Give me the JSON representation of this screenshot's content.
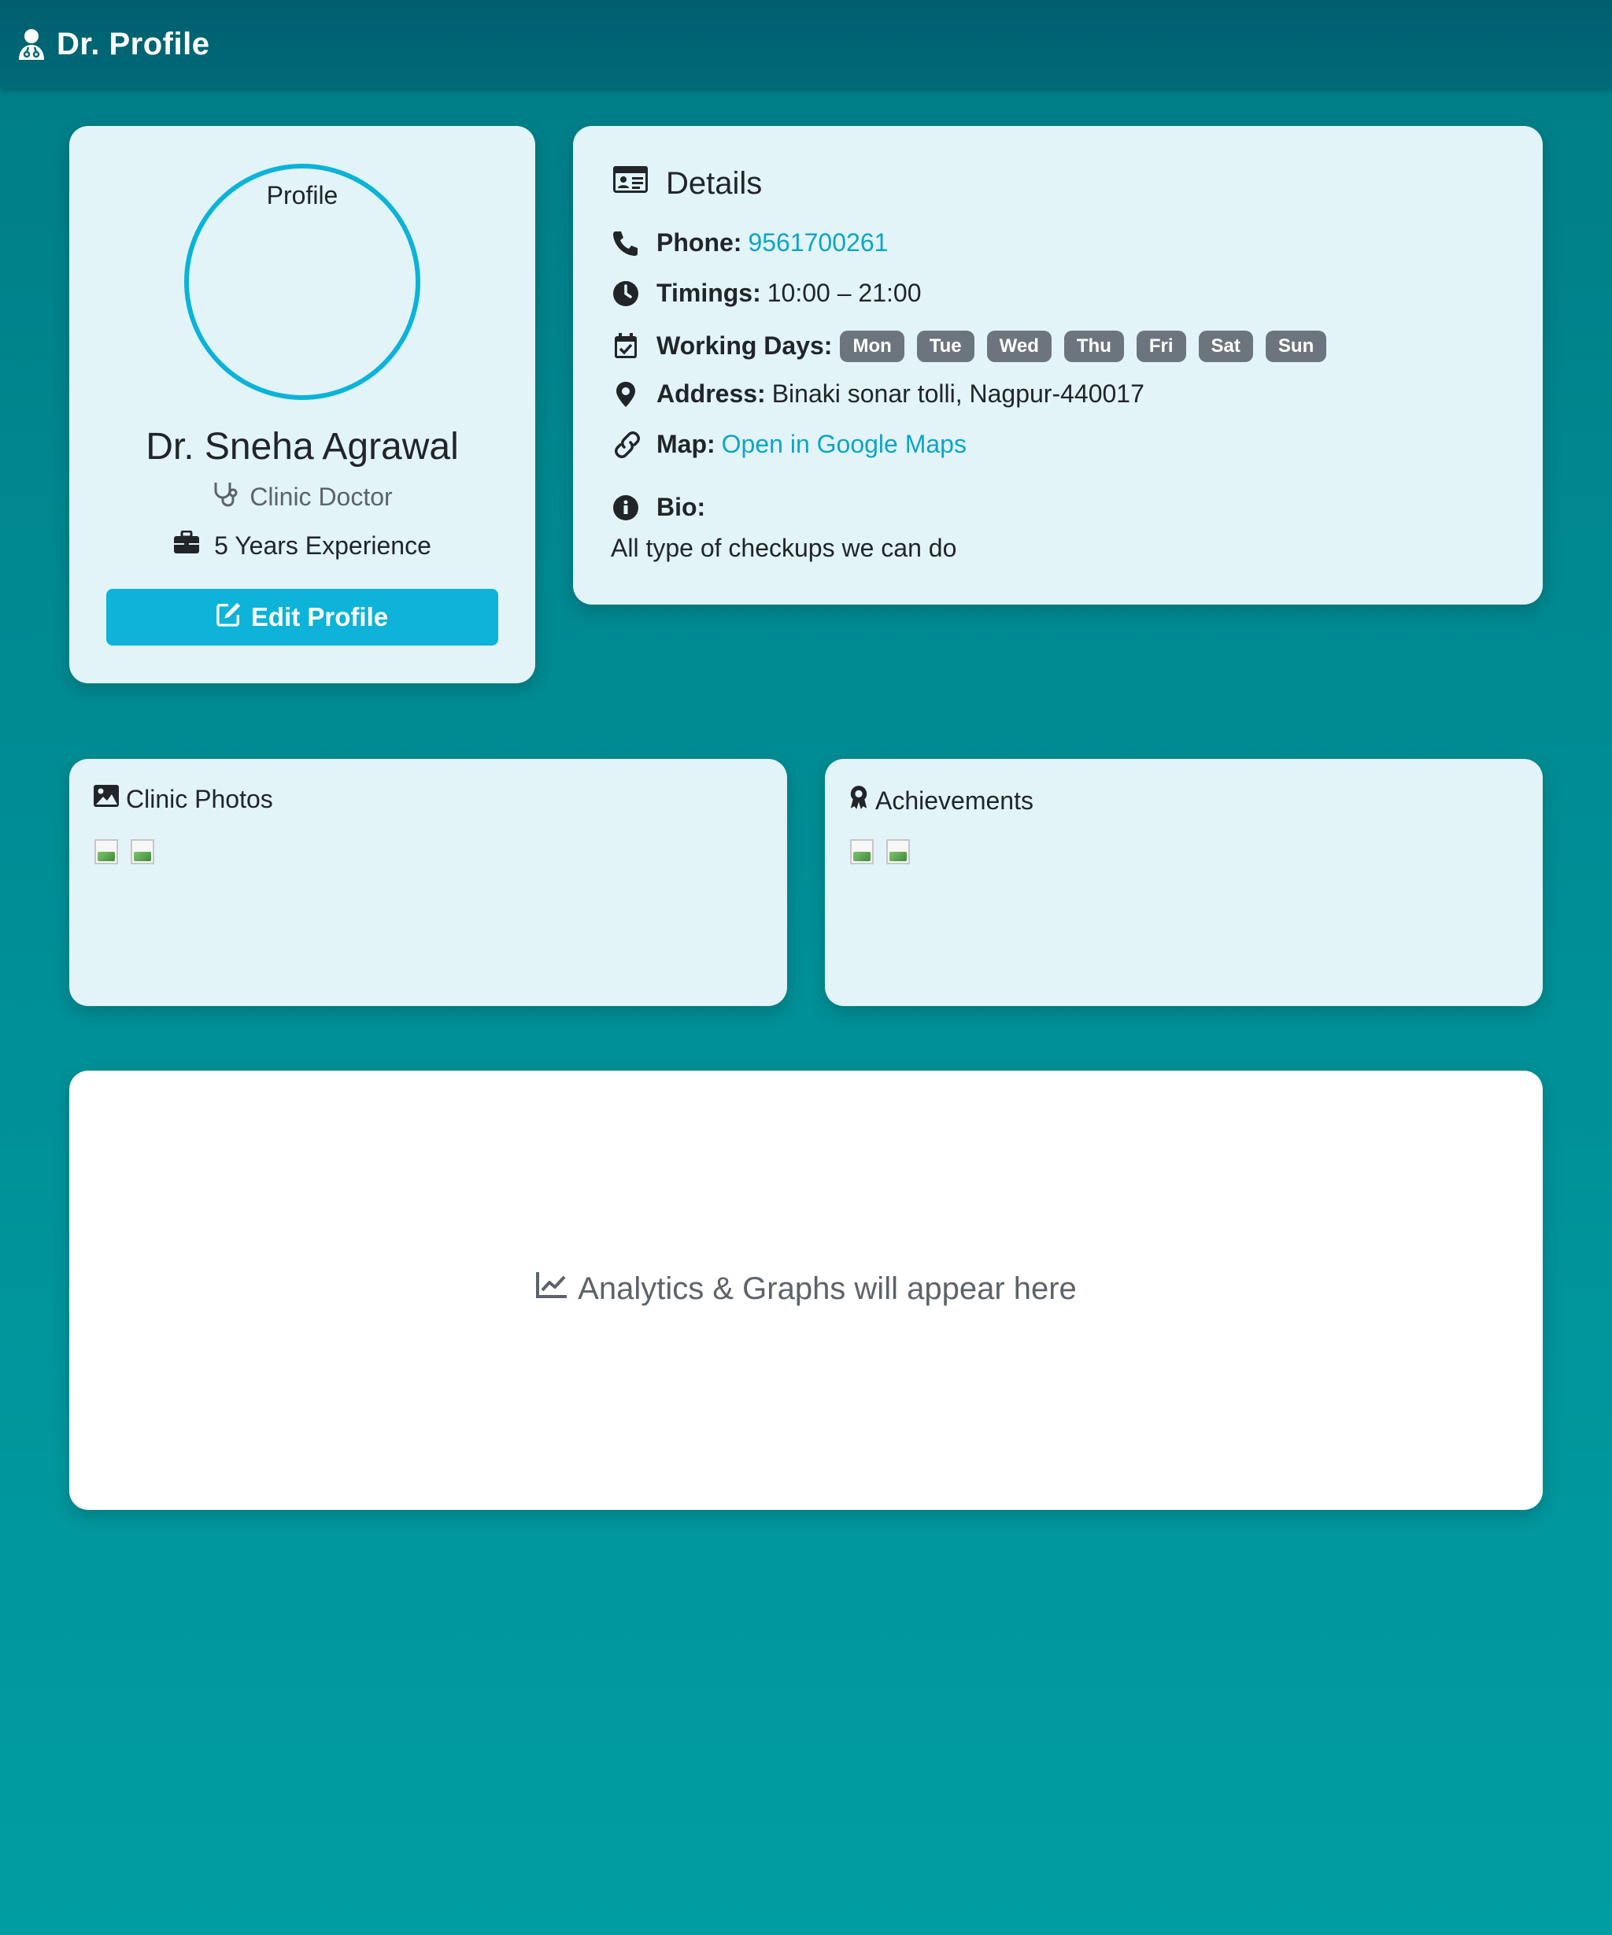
{
  "navbar": {
    "brand_icon": "doctor-icon",
    "brand": "Dr. Profile"
  },
  "profile": {
    "avatar_label": "Profile",
    "name": "Dr. Sneha Agrawal",
    "role_icon": "stethoscope-icon",
    "role": "Clinic Doctor",
    "experience_icon": "briefcase-icon",
    "experience": "5 Years Experience",
    "edit_icon": "edit-icon",
    "edit_label": "Edit Profile"
  },
  "details": {
    "title_icon": "id-card-icon",
    "title": "Details",
    "phone_label": "Phone:",
    "phone": "9561700261",
    "timings_label": "Timings:",
    "timings": "10:00 – 21:00",
    "working_days_label": "Working Days:",
    "working_days": [
      "Mon",
      "Tue",
      "Wed",
      "Thu",
      "Fri",
      "Sat",
      "Sun"
    ],
    "address_label": "Address:",
    "address": "Binaki sonar tolli, Nagpur-440017",
    "map_label": "Map:",
    "map_link": "Open in Google Maps",
    "bio_label": "Bio:",
    "bio": "All type of checkups we can do"
  },
  "photos": {
    "title_icon": "image-icon",
    "title": "Clinic Photos"
  },
  "achievements": {
    "title_icon": "award-icon",
    "title": "Achievements"
  },
  "analytics": {
    "icon": "line-chart-icon",
    "text": "Analytics & Graphs will appear here"
  },
  "colors": {
    "accent": "#0db3d8",
    "link": "#0ea5c6",
    "badge": "#6c757d",
    "navbar": "#005e6e",
    "background": "#008c94"
  }
}
